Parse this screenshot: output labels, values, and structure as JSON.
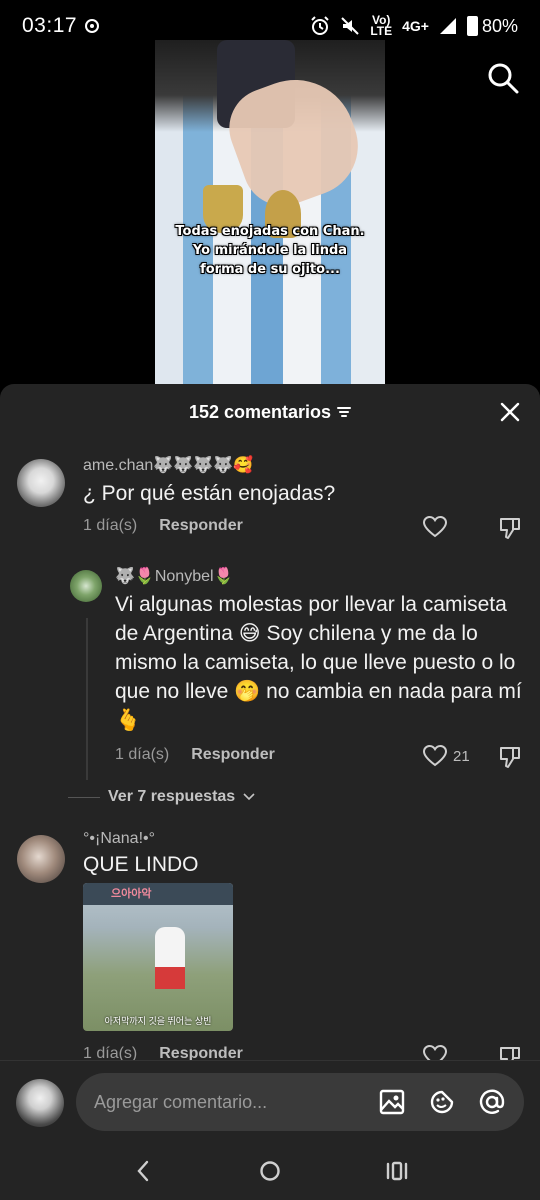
{
  "status_bar": {
    "time": "03:17",
    "network_top": "Vo)",
    "network_bottom": "LTE",
    "network_type": "4G+",
    "battery": "80%"
  },
  "video": {
    "caption_lines": [
      "Todas enojadas con Chan.",
      "Yo mirándole la linda",
      "forma de su ojito..."
    ],
    "search_icon": "search-icon"
  },
  "comments_sheet": {
    "count_label": "152 comentarios",
    "filter_icon": "filter-icon",
    "close_icon": "close-icon",
    "comments": [
      {
        "username": "ame.chan🐺🐺🐺🐺🥰",
        "text": "¿ Por qué están enojadas?",
        "time": "1 día(s)",
        "reply_label": "Responder",
        "likes": ""
      },
      {
        "username": "🐺🌷Nonybel🌷",
        "text": "Vi algunas molestas por llevar la camiseta de Argentina 😅 Soy chilena y me da lo mismo la camiseta, lo que lleve puesto o lo que no lleve 🤭 no cambia en nada para mí 🫰",
        "time": "1 día(s)",
        "reply_label": "Responder",
        "likes": "21"
      },
      {
        "username": "°•¡Nana!•°",
        "text": "QUE LINDO",
        "time": "1 día(s)",
        "reply_label": "Responder",
        "likes": ""
      }
    ],
    "view_replies_label": "Ver 7 respuestas",
    "thumb_top_label": "으아아악",
    "thumb_subtitle": "아저막까지 깃을 뛰어는 상빈"
  },
  "input_bar": {
    "placeholder": "Agregar comentario..."
  },
  "colors": {
    "sheet_bg": "#242424",
    "input_bg": "#3a3a3a",
    "secondary_text": "#9a9a9a"
  }
}
